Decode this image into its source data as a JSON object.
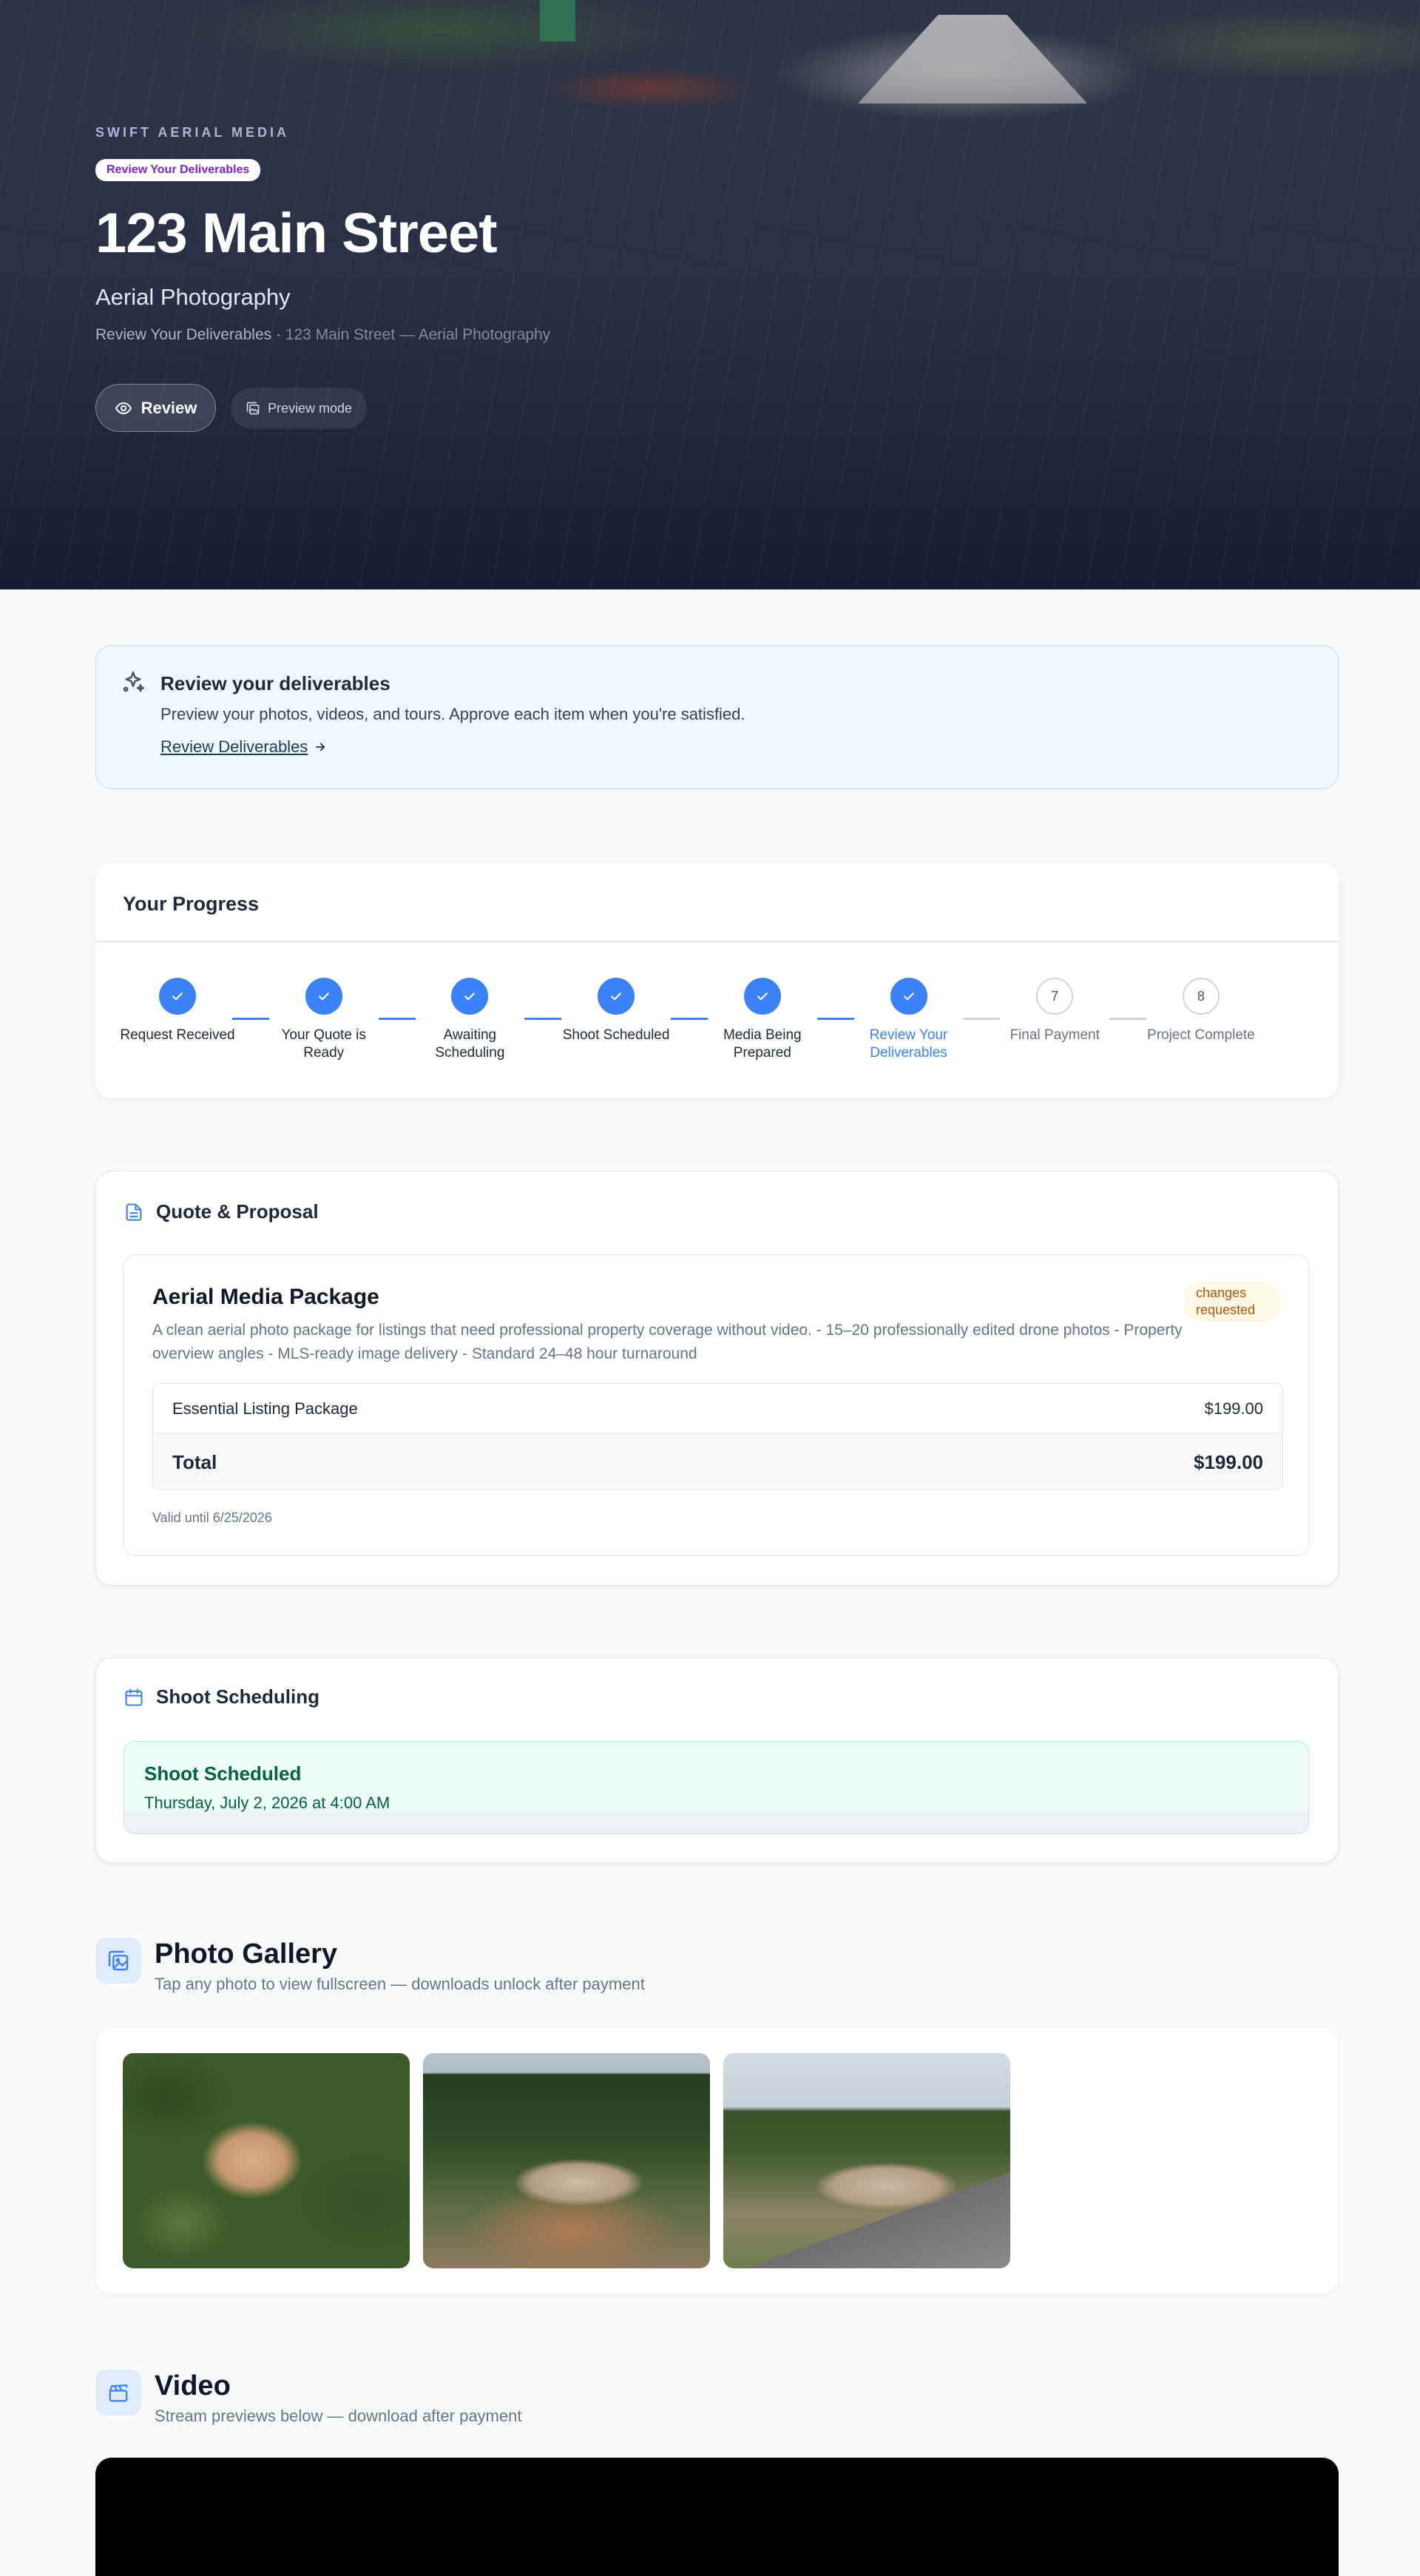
{
  "hero": {
    "brand": "SWIFT AERIAL MEDIA",
    "status_pill": "Review Your Deliverables",
    "title": "123 Main Street",
    "subtitle": "Aerial Photography",
    "crumb_stage": "Review Your Deliverables",
    "crumb_sep": " · ",
    "crumb_project": "123 Main Street — Aerial Photography",
    "review_button": "Review",
    "preview_button": "Preview mode"
  },
  "notice": {
    "title": "Review your deliverables",
    "description": "Preview your photos, videos, and tours. Approve each item when you're satisfied.",
    "link": "Review Deliverables"
  },
  "progress": {
    "title": "Your Progress",
    "steps": [
      {
        "number": "1",
        "label": "Request Received",
        "state": "done"
      },
      {
        "number": "2",
        "label": "Your Quote is Ready",
        "state": "done"
      },
      {
        "number": "3",
        "label": "Awaiting Scheduling",
        "state": "done"
      },
      {
        "number": "4",
        "label": "Shoot Scheduled",
        "state": "done"
      },
      {
        "number": "5",
        "label": "Media Being Prepared",
        "state": "done"
      },
      {
        "number": "6",
        "label": "Review Your Deliverables",
        "state": "current"
      },
      {
        "number": "7",
        "label": "Final Payment",
        "state": "todo"
      },
      {
        "number": "8",
        "label": "Project Complete",
        "state": "todo"
      }
    ]
  },
  "quote": {
    "section_title": "Quote & Proposal",
    "package_name": "Aerial Media Package",
    "status_badge": "changes requested",
    "description": "A clean aerial photo package for listings that need professional property coverage without video. - 15–20 professionally edited drone photos - Property overview angles - MLS-ready image delivery - Standard 24–48 hour turnaround",
    "line_items": [
      {
        "name": "Essential Listing Package",
        "price": "$199.00"
      }
    ],
    "total_label": "Total",
    "total_value": "$199.00",
    "valid_until": "Valid until 6/25/2026"
  },
  "schedule": {
    "section_title": "Shoot Scheduling",
    "status": "Shoot Scheduled",
    "datetime": "Thursday, July 2, 2026 at 4:00 AM"
  },
  "gallery": {
    "title": "Photo Gallery",
    "subtitle": "Tap any photo to view fullscreen — downloads unlock after payment",
    "photo_count": 3
  },
  "video": {
    "title": "Video",
    "subtitle": "Stream previews below — download after payment"
  },
  "colors": {
    "accent": "#3b82f6",
    "pending": "#d1d5db",
    "badge_text": "#b45309",
    "success_bg": "#ecfdf5"
  },
  "icons": {
    "review": "eye-icon",
    "preview": "images-icon",
    "notice": "sparkles-icon",
    "step_done": "check-icon",
    "quote": "document-icon",
    "schedule": "calendar-icon",
    "gallery": "image-icon",
    "video": "clapperboard-icon",
    "link": "arrow-right-icon"
  }
}
